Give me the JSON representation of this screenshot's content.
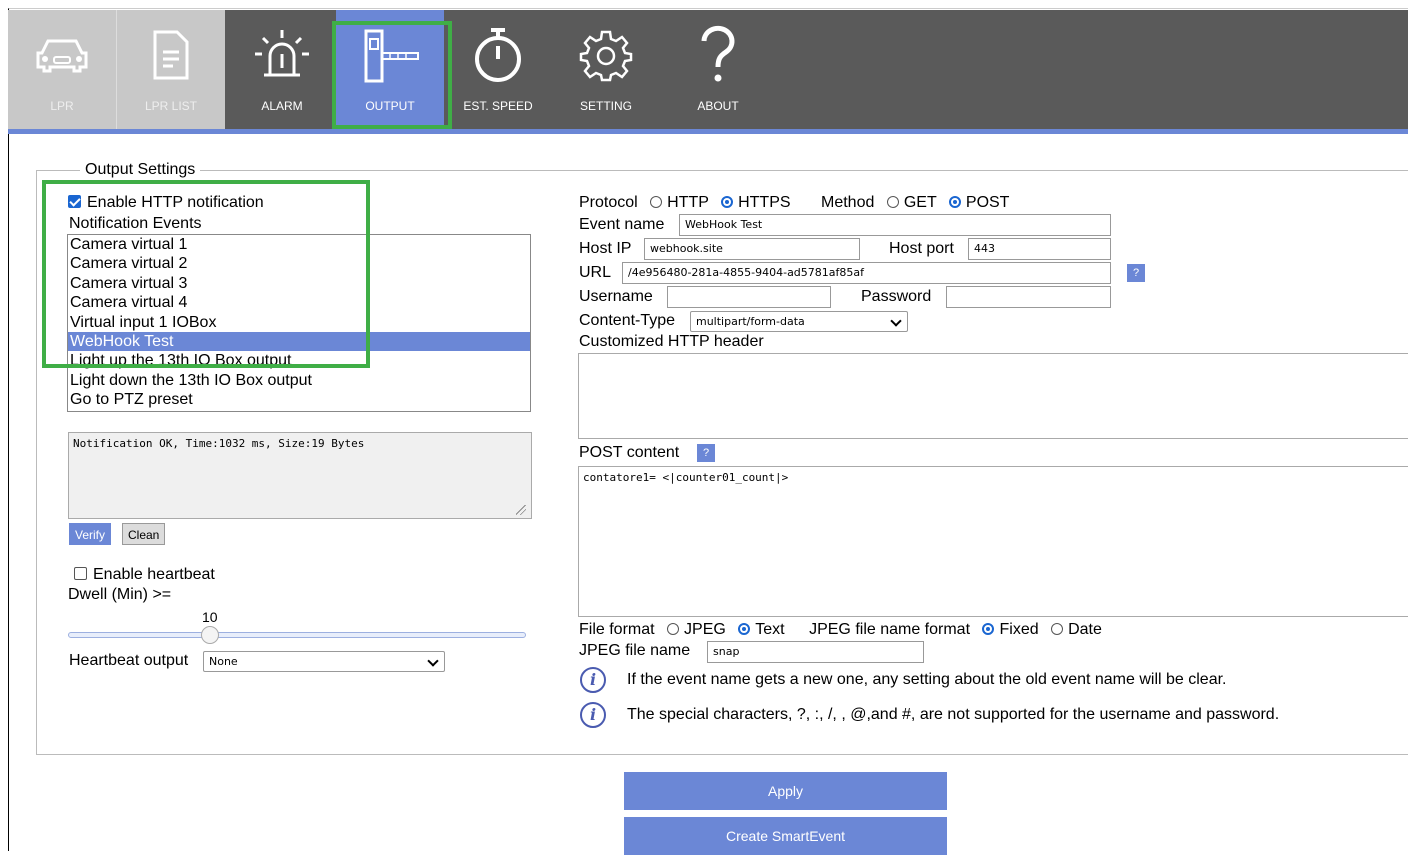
{
  "nav": {
    "items": [
      {
        "label": "LPR",
        "icon": "car-icon",
        "state": "disabled"
      },
      {
        "label": "LPR LIST",
        "icon": "document-list-icon",
        "state": "disabled"
      },
      {
        "label": "ALARM",
        "icon": "alarm-siren-icon",
        "state": "normal"
      },
      {
        "label": "OUTPUT",
        "icon": "barrier-gate-icon",
        "state": "active"
      },
      {
        "label": "EST. SPEED",
        "icon": "stopwatch-icon",
        "state": "normal"
      },
      {
        "label": "SETTING",
        "icon": "gear-icon",
        "state": "normal"
      },
      {
        "label": "ABOUT",
        "icon": "question-mark-icon",
        "state": "normal"
      }
    ],
    "highlight_color": "#3fae46",
    "active_color": "#6b87d6"
  },
  "output_settings": {
    "legend": "Output Settings",
    "enable_http_label": "Enable HTTP notification",
    "enable_http_checked": true,
    "events_label": "Notification Events",
    "events": [
      "Camera virtual 1",
      "Camera virtual 2",
      "Camera virtual 3",
      "Camera virtual 4",
      "Virtual input 1 IOBox",
      "WebHook Test",
      "Light up the 13th IO Box output",
      "Light down the 13th IO Box output",
      "Go to PTZ preset"
    ],
    "selected_event": "WebHook Test",
    "result_text": "Notification OK, Time:1032 ms, Size:19 Bytes",
    "verify_label": "Verify",
    "clean_label": "Clean",
    "heartbeat_label": "Enable heartbeat",
    "heartbeat_checked": false,
    "dwell_label": "Dwell (Min) >=",
    "dwell_value": "10",
    "heartbeat_output_label": "Heartbeat output",
    "heartbeat_output_value": "None"
  },
  "http": {
    "protocol_label": "Protocol",
    "protocol_options": [
      "HTTP",
      "HTTPS"
    ],
    "protocol_selected": "HTTPS",
    "method_label": "Method",
    "method_options": [
      "GET",
      "POST"
    ],
    "method_selected": "POST",
    "event_name_label": "Event name",
    "event_name_value": "WebHook Test",
    "host_ip_label": "Host IP",
    "host_ip_value": "webhook.site",
    "host_port_label": "Host port",
    "host_port_value": "443",
    "url_label": "URL",
    "url_value": "/4e956480-281a-4855-9404-ad5781af85af",
    "help_label": "?",
    "username_label": "Username",
    "username_value": "",
    "password_label": "Password",
    "password_value": "",
    "content_type_label": "Content-Type",
    "content_type_value": "multipart/form-data",
    "custom_header_label": "Customized HTTP header",
    "custom_header_value": "",
    "post_content_label": "POST content",
    "post_content_value": "contatore1= <|counter01_count|>",
    "file_format_label": "File format",
    "file_format_options": [
      "JPEG",
      "Text"
    ],
    "file_format_selected": "Text",
    "jpeg_name_format_label": "JPEG file name format",
    "jpeg_name_format_options": [
      "Fixed",
      "Date"
    ],
    "jpeg_name_format_selected": "Fixed",
    "jpeg_file_name_label": "JPEG file name",
    "jpeg_file_name_value": "snap",
    "info1": "If the event name gets a new one, any setting about the old event name will be clear.",
    "info2": "The special characters, ?, :, /, , @,and #, are not supported for the username and password."
  },
  "footer": {
    "apply_label": "Apply",
    "smartevent_label": "Create SmartEvent"
  }
}
